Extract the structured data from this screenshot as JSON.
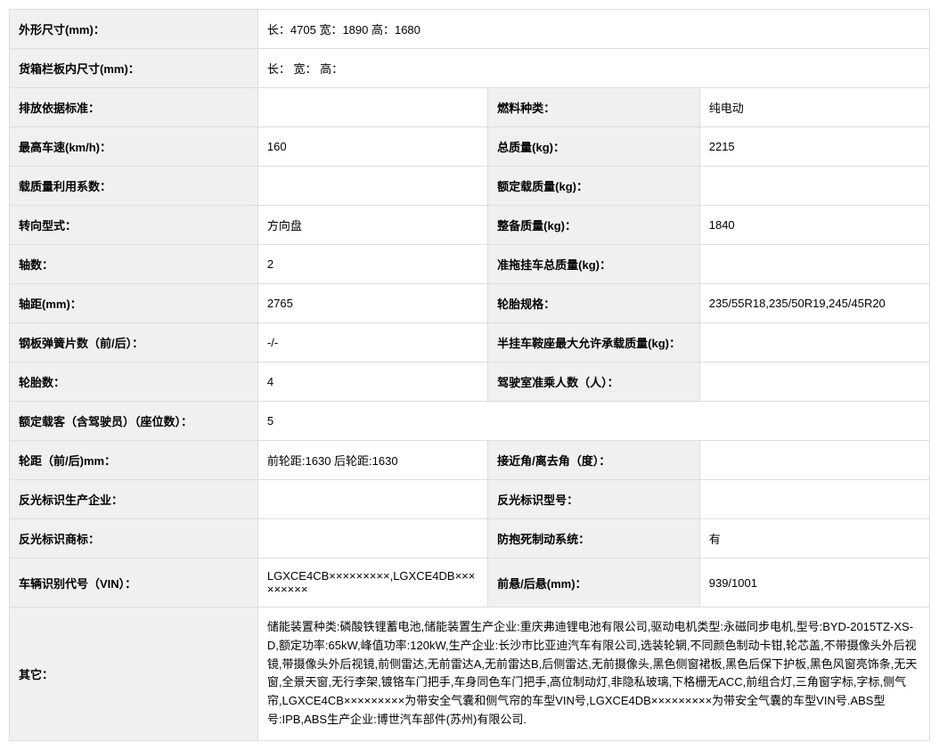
{
  "rows": {
    "dim_label": "外形尺寸(mm)：",
    "dim_value": "长：4705 宽：1890 高：1680",
    "cargo_label": "货箱栏板内尺寸(mm)：",
    "cargo_value": "长： 宽： 高：",
    "emission_label": "排放依据标准：",
    "emission_value": "",
    "fuel_label": "燃料种类：",
    "fuel_value": "纯电动",
    "speed_label": "最高车速(km/h)：",
    "speed_value": "160",
    "gross_label": "总质量(kg)：",
    "gross_value": "2215",
    "load_coef_label": "载质量利用系数：",
    "load_coef_value": "",
    "rated_load_label": "额定载质量(kg)：",
    "rated_load_value": "",
    "steering_label": "转向型式：",
    "steering_value": "方向盘",
    "curb_label": "整备质量(kg)：",
    "curb_value": "1840",
    "axle_label": "轴数：",
    "axle_value": "2",
    "trailer_label": "准拖挂车总质量(kg)：",
    "trailer_value": "",
    "wheelbase_label": "轴距(mm)：",
    "wheelbase_value": "2765",
    "tire_spec_label": "轮胎规格：",
    "tire_spec_value": "235/55R18,235/50R19,245/45R20",
    "spring_label": "钢板弹簧片数（前/后）：",
    "spring_value": "-/-",
    "saddle_label": "半挂车鞍座最大允许承载质量(kg)：",
    "saddle_value": "",
    "tire_count_label": "轮胎数：",
    "tire_count_value": "4",
    "cab_label": "驾驶室准乘人数（人）：",
    "cab_value": "",
    "passenger_label": "额定载客（含驾驶员）（座位数）：",
    "passenger_value": "5",
    "track_label": "轮距（前/后)mm：",
    "track_value": "前轮距:1630 后轮距:1630",
    "approach_label": "接近角/离去角（度）：",
    "approach_value": "",
    "refl_mfr_label": "反光标识生产企业：",
    "refl_mfr_value": "",
    "refl_model_label": "反光标识型号：",
    "refl_model_value": "",
    "refl_tm_label": "反光标识商标：",
    "refl_tm_value": "",
    "abs_label": "防抱死制动系统：",
    "abs_value": "有",
    "vin_label": "车辆识别代号（VIN）：",
    "vin_value": "LGXCE4CB×××××××××,LGXCE4DB×××××××××",
    "overhang_label": "前悬/后悬(mm)：",
    "overhang_value": "939/1001",
    "other_label": "其它：",
    "other_value": "储能装置种类:磷酸铁锂蓄电池,储能装置生产企业:重庆弗迪锂电池有限公司,驱动电机类型:永磁同步电机,型号:BYD-2015TZ-XS-D,额定功率:65kW,峰值功率:120kW,生产企业:长沙市比亚迪汽车有限公司,选装轮辋,不同颜色制动卡钳,轮芯盖,不带摄像头外后视镜,带摄像头外后视镜,前侧雷达,无前雷达A,无前雷达B,后侧雷达,无前摄像头,黑色侧窗裙板,黑色后保下护板,黑色风窗亮饰条,无天窗,全景天窗,无行李架,镀铬车门把手,车身同色车门把手,高位制动灯,非隐私玻璃,下格栅无ACC,前组合灯,三角窗字标,字标,侧气帘,LGXCE4CB×××××××××为带安全气囊和侧气帘的车型VIN号,LGXCE4DB×××××××××为带安全气囊的车型VIN号.ABS型号:IPB,ABS生产企业:博世汽车部件(苏州)有限公司."
  }
}
